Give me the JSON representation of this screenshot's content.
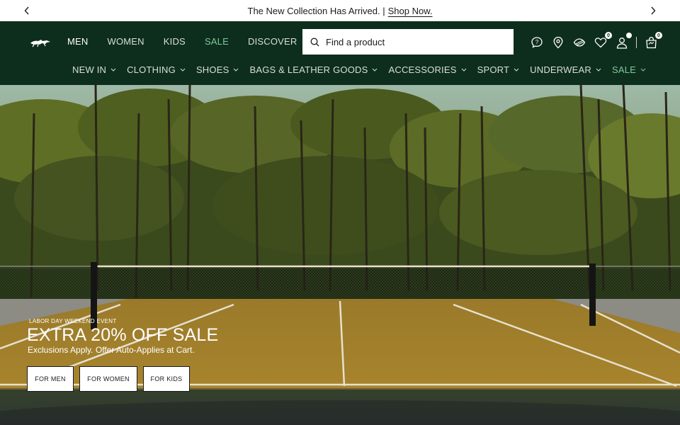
{
  "announcement": {
    "text": "The New Collection Has Arrived. |",
    "link": "Shop Now."
  },
  "header": {
    "top_nav": [
      "MEN",
      "WOMEN",
      "KIDS",
      "SALE",
      "DISCOVER"
    ],
    "search_placeholder": "Find a product",
    "wishlist_count": "0",
    "cart_count": "0",
    "categories": [
      "NEW IN",
      "CLOTHING",
      "SHOES",
      "BAGS & LEATHER GOODS",
      "ACCESSORIES",
      "SPORT",
      "UNDERWEAR",
      "SALE"
    ]
  },
  "hero": {
    "eyebrow": "LABOR DAY WEEKEND EVENT",
    "headline": "EXTRA 20% OFF SALE",
    "subline": "Exclusions Apply. Offer Auto-Applies at Cart.",
    "buttons": [
      "FOR MEN",
      "FOR WOMEN",
      "FOR KIDS"
    ]
  },
  "colors": {
    "header_bg": "#0e2e1d",
    "sale_accent": "#7ec89a"
  }
}
